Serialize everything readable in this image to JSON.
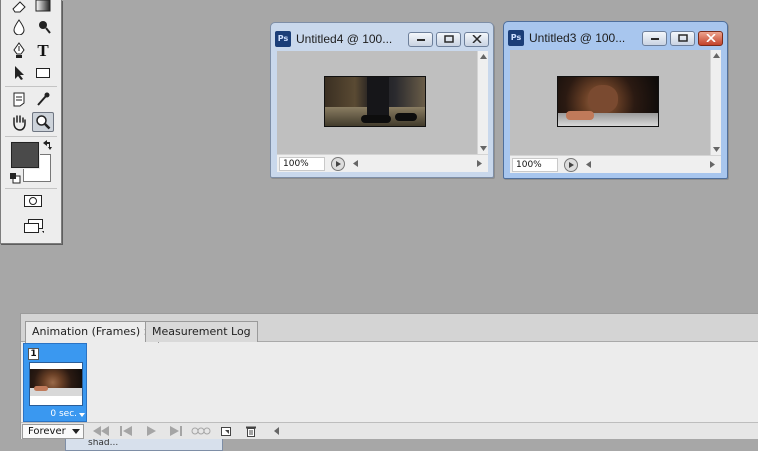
{
  "tools_panel": {
    "tools": [
      {
        "name": "eraser-tool",
        "icon": "eraser-icon"
      },
      {
        "name": "gradient-tool",
        "icon": "gradient-icon"
      },
      {
        "name": "blur-tool",
        "icon": "droplet-icon"
      },
      {
        "name": "dodge-tool",
        "icon": "dodge-icon"
      },
      {
        "name": "pen-tool",
        "icon": "pen-icon"
      },
      {
        "name": "type-tool",
        "icon": "type-icon",
        "glyph": "T"
      },
      {
        "name": "path-selection-tool",
        "icon": "arrow-pointer-icon"
      },
      {
        "name": "rectangle-tool",
        "icon": "rectangle-icon"
      },
      {
        "name": "notes-tool",
        "icon": "notes-icon"
      },
      {
        "name": "eyedropper-tool",
        "icon": "eyedropper-icon"
      },
      {
        "name": "hand-tool",
        "icon": "hand-icon"
      },
      {
        "name": "zoom-tool",
        "icon": "magnifier-icon",
        "active": true
      }
    ],
    "foreground_color": "#4a4a4a",
    "background_color": "#ffffff"
  },
  "windows": [
    {
      "title": "Untitled4 @ 100...",
      "zoom": "100%",
      "active": false
    },
    {
      "title": "Untitled3 @ 100...",
      "zoom": "100%",
      "active": true
    }
  ],
  "animation_panel": {
    "tabs": [
      {
        "label": "Animation (Frames)",
        "active": true,
        "close": "×"
      },
      {
        "label": "Measurement Log",
        "active": false
      }
    ],
    "frames": [
      {
        "number": "1",
        "delay": "0 sec.",
        "selected": true
      }
    ],
    "loop_option": "Forever"
  },
  "minimized_window": {
    "title": "shad..."
  },
  "colors": {
    "workspace": "#a7a7a7",
    "frame_selected": "#3a98f0",
    "titlebar_active": "#a8c6ee",
    "titlebar_inactive": "#c9d8ec"
  }
}
